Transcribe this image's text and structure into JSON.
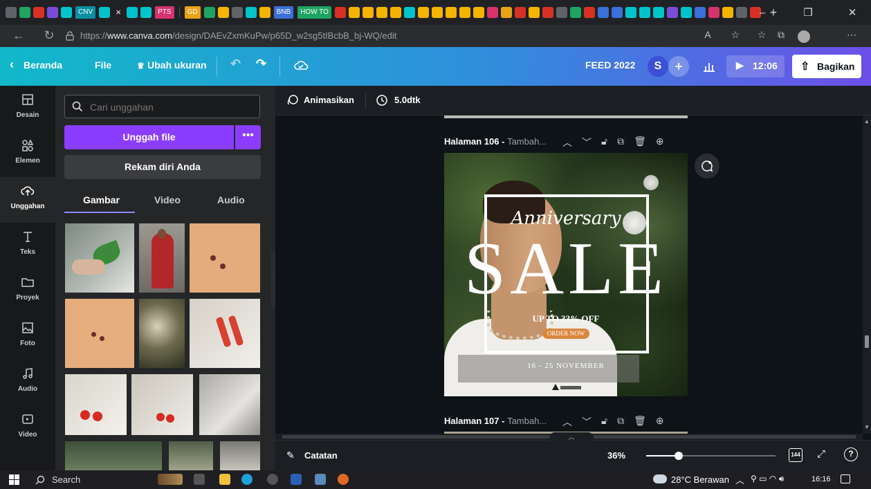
{
  "browser": {
    "tab_labels": [
      "CNV",
      "PTS",
      "GD",
      "BNB",
      "HOW TO"
    ],
    "url_prefix": "https://",
    "url_domain": "www.canva.com",
    "url_path": "/design/DAEvZxmKuPw/p65D_w2sg5tIBcbB_bj-WQ/edit"
  },
  "header": {
    "home_label": "Beranda",
    "file_label": "File",
    "resize_label": "Ubah ukuran",
    "doc_title": "FEED 2022",
    "avatar_letter": "S",
    "timer": "12:06",
    "share_label": "Bagikan"
  },
  "rail": {
    "items": [
      {
        "label": "Desain"
      },
      {
        "label": "Elemen"
      },
      {
        "label": "Unggahan"
      },
      {
        "label": "Teks"
      },
      {
        "label": "Proyek"
      },
      {
        "label": "Foto"
      },
      {
        "label": "Audio"
      },
      {
        "label": "Video"
      }
    ]
  },
  "panel": {
    "search_placeholder": "Cari unggahan",
    "upload_label": "Unggah file",
    "more_label": "•••",
    "record_label": "Rekam diri Anda",
    "tabs": [
      "Gambar",
      "Video",
      "Audio"
    ]
  },
  "toolbar": {
    "animate_label": "Animasikan",
    "duration_label": "5.0dtk"
  },
  "pages": [
    {
      "title": "Halaman 106 -",
      "subtitle": "Tambah..."
    },
    {
      "title": "Halaman 107 -",
      "subtitle": "Tambah..."
    }
  ],
  "design": {
    "script_title": "Anniversary",
    "main_text": "SALE",
    "offer": "UP TO 33% OFF",
    "cta": "ORDER NOW",
    "dates": "16 - 25 NOVEMBER"
  },
  "footer": {
    "notes_label": "Catatan",
    "zoom": "36%",
    "zoom_level": 0.25,
    "page_count": "144"
  },
  "taskbar": {
    "search_label": "Search",
    "weather": "28°C Berawan",
    "time": "16:16"
  },
  "colors": {
    "accent_purple": "#8b3dff",
    "header_start": "#11b8c9",
    "header_end": "#6c4fe8",
    "cta_orange": "#d9873f"
  }
}
